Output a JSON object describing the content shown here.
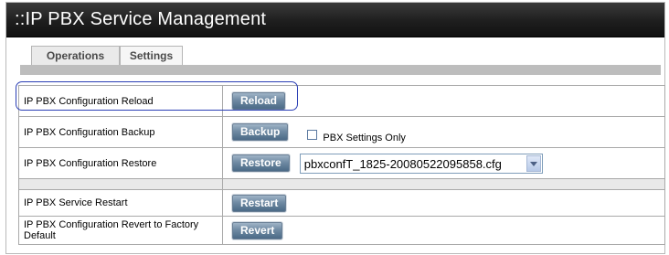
{
  "header": {
    "title": "::IP PBX Service Management"
  },
  "tabs": [
    {
      "label": "Operations",
      "active": true
    },
    {
      "label": "Settings",
      "active": false
    }
  ],
  "rows": [
    {
      "label": "IP PBX Configuration Reload",
      "button": "Reload"
    },
    {
      "label": "IP PBX Configuration Backup",
      "button": "Backup",
      "checkbox_label": "PBX Settings Only",
      "checkbox_checked": false
    },
    {
      "label": "IP PBX Configuration Restore",
      "button": "Restore",
      "select_value": "pbxconfT_1825-20080522095858.cfg"
    },
    {
      "label": "IP PBX Service Restart",
      "button": "Restart"
    },
    {
      "label": "IP PBX Configuration Revert to Factory Default",
      "button": "Revert"
    }
  ],
  "colors": {
    "title_bar": "#1e1e1e",
    "button": "#6f8aa3",
    "highlight_outline": "#2b3fb5"
  }
}
